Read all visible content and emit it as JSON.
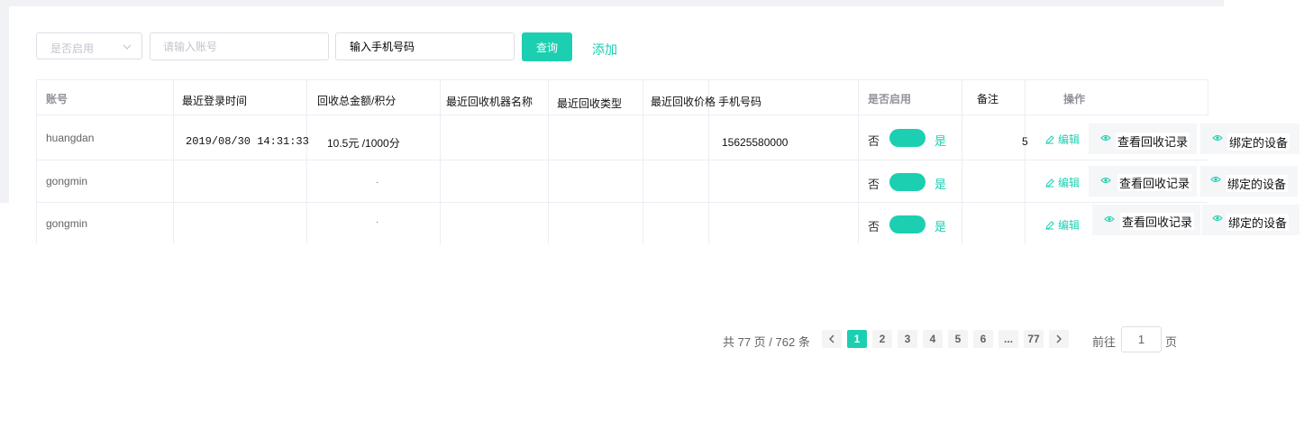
{
  "filters": {
    "enabled_select": {
      "value": "是否启用"
    },
    "account_input": {
      "placeholder": "请输入账号"
    },
    "phone_input": {
      "placeholder": "输入手机号码"
    },
    "query_label": "查询",
    "add_label": "添加"
  },
  "table": {
    "headers": {
      "account": "账号",
      "last_login": "最近登录时间",
      "recycle_total": "回收总金额/积分",
      "last_machine": "最近回收机器名称",
      "last_type": "最近回收类型",
      "last_price": "最近回收价格",
      "phone": "手机号码",
      "enabled": "是否启用",
      "remark": "备注",
      "actions": "操作"
    },
    "rows": [
      {
        "account": "huangdan",
        "last_login": "2019/08/30 14:31:33",
        "recycle_total": "10.5元 /1000分",
        "phone": "15625580000",
        "off": "否",
        "on": "是",
        "remark_fragment": "5"
      },
      {
        "account": "gongmin",
        "last_login": "",
        "recycle_total": "",
        "phone": "",
        "off": "否",
        "on": "是"
      },
      {
        "account": "gongmin",
        "last_login": "",
        "recycle_total": "",
        "phone": "",
        "off": "否",
        "on": "是"
      }
    ],
    "actions": {
      "edit": "编辑",
      "view_records": "查看回收记录",
      "bound_devices": "绑定的设备"
    }
  },
  "pagination": {
    "total_text": "共 77 页 / 762 条",
    "pages": [
      "1",
      "2",
      "3",
      "4",
      "5",
      "6",
      "...",
      "77"
    ],
    "current": "1",
    "jump_prefix": "前往",
    "jump_value": "1",
    "jump_suffix": "页"
  },
  "colors": {
    "accent": "#1ccfb1",
    "border": "#ebeef5",
    "page_bg": "#f0f2f5"
  }
}
